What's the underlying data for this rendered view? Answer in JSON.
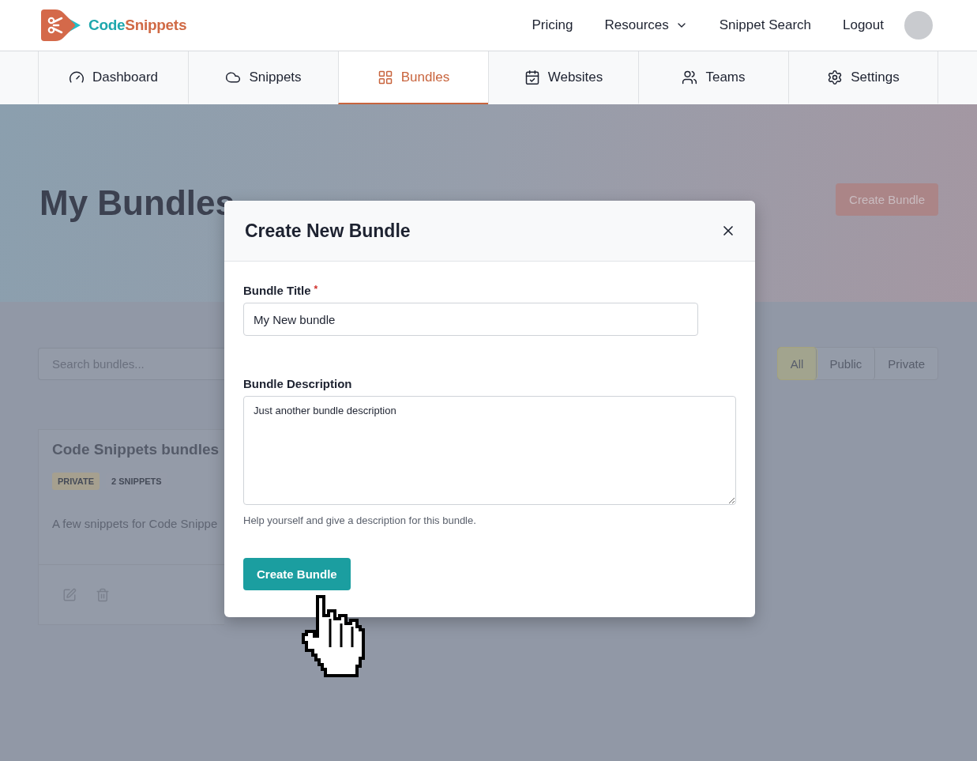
{
  "logo": {
    "part_a": "Code",
    "part_b": "Snippets"
  },
  "top_nav": [
    {
      "label": "Pricing",
      "kind": "link"
    },
    {
      "label": "Resources",
      "kind": "dropdown"
    },
    {
      "label": "Snippet Search",
      "kind": "link"
    },
    {
      "label": "Logout",
      "kind": "link"
    }
  ],
  "tabs": [
    {
      "label": "Dashboard",
      "selected": false
    },
    {
      "label": "Snippets",
      "selected": false
    },
    {
      "label": "Bundles",
      "selected": true
    },
    {
      "label": "Websites",
      "selected": false
    },
    {
      "label": "Teams",
      "selected": false
    },
    {
      "label": "Settings",
      "selected": false
    }
  ],
  "page": {
    "title": "My Bundles",
    "create_button": "Create Bundle",
    "search": {
      "placeholder": "Search bundles..."
    },
    "filters": [
      {
        "label": "All",
        "selected": true
      },
      {
        "label": "Public",
        "selected": false
      },
      {
        "label": "Private",
        "selected": false
      }
    ],
    "bundles": [
      {
        "title": "Code Snippets bundles",
        "tags": [
          {
            "label": "PRIVATE",
            "color": "#a6a08f"
          },
          {
            "label": "2 SNIPPETS",
            "color": "#959ba8"
          }
        ],
        "description": "A few snippets for Code Snippe"
      }
    ]
  },
  "modal": {
    "title": "Create New Bundle",
    "title_field": {
      "label": "Bundle Title",
      "required_mark": "*",
      "value": "My New bundle"
    },
    "description_field": {
      "label": "Bundle Description",
      "value": "Just another bundle description",
      "help": "Help yourself and give a description for this bundle."
    },
    "submit": "Create Bundle"
  }
}
